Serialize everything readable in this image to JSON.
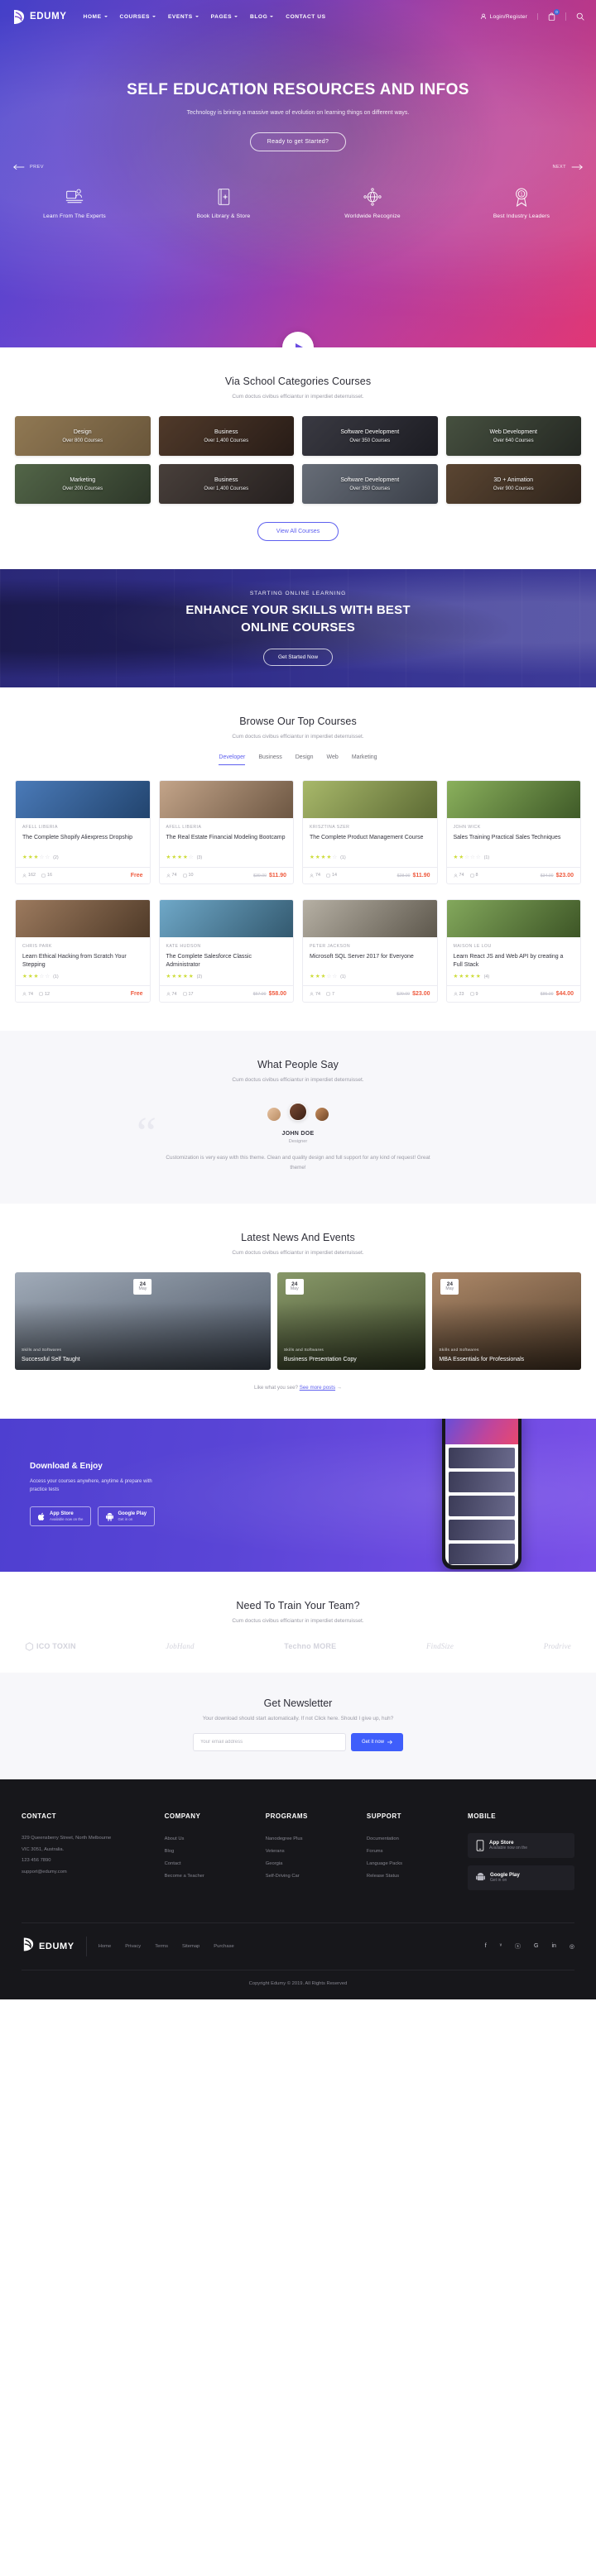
{
  "header": {
    "brand": "EDUMY",
    "nav": [
      {
        "label": "HOME",
        "has_caret": true
      },
      {
        "label": "COURSES",
        "has_caret": true
      },
      {
        "label": "EVENTS",
        "has_caret": true
      },
      {
        "label": "PAGES",
        "has_caret": true
      },
      {
        "label": "BLOG",
        "has_caret": true
      },
      {
        "label": "CONTACT US",
        "has_caret": false
      }
    ],
    "login_label": "Login/Register",
    "cart_count": "0"
  },
  "hero": {
    "title": "SELF EDUCATION RESOURCES AND INFOS",
    "subtitle": "Technology is brining a massive wave of evolution on learning things on different ways.",
    "cta": "Ready to get Started?",
    "prev_label": "PREV",
    "next_label": "NEXT",
    "features": [
      {
        "label": "Learn From The Experts",
        "icon": "expert-desk-icon"
      },
      {
        "label": "Book Library & Store",
        "icon": "book-plus-icon"
      },
      {
        "label": "Worldwide Recognize",
        "icon": "globe-network-icon"
      },
      {
        "label": "Best Industry Leaders",
        "icon": "award-ribbon-icon"
      }
    ]
  },
  "categories": {
    "title": "Via School Categories Courses",
    "subtitle": "Cum doctus civibus efficiantur in imperdiet deterruisset.",
    "items": [
      {
        "name": "Design",
        "count": "Over 800 Courses",
        "c1": "#c9a66b",
        "c2": "#8f7346"
      },
      {
        "name": "Business",
        "count": "Over 1,400 Courses",
        "c1": "#6b4a2e",
        "c2": "#2e1d12"
      },
      {
        "name": "Software Development",
        "count": "Over 350 Courses",
        "c1": "#4a4a52",
        "c2": "#1d1d22"
      },
      {
        "name": "Web Development",
        "count": "Over 640 Courses",
        "c1": "#5c6b4e",
        "c2": "#2a2f23"
      },
      {
        "name": "Marketing",
        "count": "Over 200 Courses",
        "c1": "#6e8a5a",
        "c2": "#37452c"
      },
      {
        "name": "Business",
        "count": "Over 1,400 Courses",
        "c1": "#5f5247",
        "c2": "#2b231d"
      },
      {
        "name": "Software Development",
        "count": "Over 350 Courses",
        "c1": "#8c95a0",
        "c2": "#4a515a"
      },
      {
        "name": "3D + Animation",
        "count": "Over 900 Courses",
        "c1": "#7a5b3a",
        "c2": "#3a2a19"
      }
    ],
    "view_all": "View All Courses"
  },
  "enhance": {
    "kicker": "STARTING ONLINE LEARNING",
    "title_line1": "ENHANCE YOUR SKILLS WITH BEST",
    "title_line2": "ONLINE COURSES",
    "cta": "Get Started Now"
  },
  "courses": {
    "title": "Browse Our Top Courses",
    "subtitle": "Cum doctus civibus efficiantur in imperdiet deterruisset.",
    "tabs": [
      {
        "label": "Developer",
        "active": true
      },
      {
        "label": "Business",
        "active": false
      },
      {
        "label": "Design",
        "active": false
      },
      {
        "label": "Web",
        "active": false
      },
      {
        "label": "Marketing",
        "active": false
      }
    ],
    "items": [
      {
        "author": "AFELL LIBERIA",
        "title": "The Complete Shopify Aliexpress Dropship",
        "rating": 2.5,
        "reviews": "(2)",
        "students": "162",
        "lessons": "16",
        "old_price": "",
        "price": "Free",
        "free": true,
        "c1": "#4a7ab8",
        "c2": "#22446e"
      },
      {
        "author": "AFELL LIBERIA",
        "title": "The Real Estate Financial Modeling Bootcamp",
        "rating": 4.0,
        "reviews": "(3)",
        "students": "74",
        "lessons": "10",
        "old_price": "$39.00",
        "price": "$11.90",
        "free": false,
        "c1": "#c3a489",
        "c2": "#6d5743"
      },
      {
        "author": "KRISZTINA SZER",
        "title": "The Complete Product Management Course",
        "rating": 4.0,
        "reviews": "(1)",
        "students": "74",
        "lessons": "14",
        "old_price": "$28.00",
        "price": "$11.90",
        "free": false,
        "c1": "#a8b86a",
        "c2": "#5c6a34"
      },
      {
        "author": "JOHN WICK",
        "title": "Sales Training Practical Sales Techniques",
        "rating": 2.0,
        "reviews": "(1)",
        "students": "74",
        "lessons": "8",
        "old_price": "$34.00",
        "price": "$23.00",
        "free": false,
        "c1": "#8ab05c",
        "c2": "#3f5a28"
      },
      {
        "author": "CHRIS PARK",
        "title": "Learn Ethical Hacking from Scratch Your Stepping",
        "rating": 3.0,
        "reviews": "(1)",
        "students": "74",
        "lessons": "12",
        "old_price": "",
        "price": "Free",
        "free": true,
        "c1": "#9c7a5e",
        "c2": "#4f3a28"
      },
      {
        "author": "KATE HUDSON",
        "title": "The Complete Salesforce Classic Administrator",
        "rating": 4.5,
        "reviews": "(2)",
        "students": "74",
        "lessons": "17",
        "old_price": "$67.00",
        "price": "$58.00",
        "free": false,
        "c1": "#6fa8c8",
        "c2": "#33596f"
      },
      {
        "author": "PETER JACKSON",
        "title": "Microsoft SQL Server 2017 for Everyone",
        "rating": 3.0,
        "reviews": "(1)",
        "students": "74",
        "lessons": "7",
        "old_price": "$29.00",
        "price": "$23.00",
        "free": false,
        "c1": "#b6b0a4",
        "c2": "#5d574c"
      },
      {
        "author": "MAISON LE LOU",
        "title": "Learn React JS and Web API by creating a Full Stack",
        "rating": 5.0,
        "reviews": "(4)",
        "students": "23",
        "lessons": "9",
        "old_price": "$85.00",
        "price": "$44.00",
        "free": false,
        "c1": "#83a85c",
        "c2": "#3d5526"
      }
    ]
  },
  "testimonials": {
    "title": "What People Say",
    "subtitle": "Cum doctus civibus efficiantur in imperdiet deterruisset.",
    "name": "JOHN DOE",
    "role": "Designer",
    "quote": "Customization is very easy with this theme. Clean and quality design and full support for any kind of request! Great theme!"
  },
  "news": {
    "title": "Latest News And Events",
    "subtitle": "Cum doctus civibus efficiantur in imperdiet deterruisset.",
    "items": [
      {
        "day": "24",
        "month": "May",
        "tagline": "Skills and Softwares",
        "title": "Successful Self Taught",
        "c1": "#a9b4c2",
        "c2": "#4c5665"
      },
      {
        "day": "24",
        "month": "May",
        "tagline": "Skills and Softwares",
        "title": "Business Presentation Copy",
        "c1": "#8fa06e",
        "c2": "#3f4a2b"
      },
      {
        "day": "24",
        "month": "May",
        "tagline": "Skills and Softwares",
        "title": "MBA Essentials for Professionals",
        "c1": "#b58f6e",
        "c2": "#56402c"
      }
    ],
    "more_prefix": "Like what you see?",
    "more_link": "See more posts"
  },
  "app": {
    "title": "Download & Enjoy",
    "desc": "Access your courses anywhere, anytime & prepare with practice tests",
    "stores": [
      {
        "name": "App Store",
        "sub": "Available now on the",
        "icon": "apple-icon"
      },
      {
        "name": "Google Play",
        "sub": "Get in on",
        "icon": "android-icon"
      }
    ]
  },
  "partnersSection": {
    "title": "Need To Train Your Team?",
    "subtitle": "Cum doctus civibus efficiantur in imperdiet deterruisset.",
    "logos": [
      "ICO TOXIN",
      "JobHand",
      "Techno MORE",
      "FindSize",
      "Prodrive"
    ]
  },
  "newsletter": {
    "title": "Get Newsletter",
    "subtitle": "Your download should start automatically. If not Click here. Should I give up, huh?",
    "placeholder": "Your email address",
    "button": "Get it now"
  },
  "footer": {
    "columns": [
      {
        "head": "CONTACT",
        "lines": [
          "329 Queensberry Street, North Melbourne",
          "VIC 3051, Australia.",
          "123 456 7890",
          "support@edumy.com"
        ],
        "links": []
      },
      {
        "head": "COMPANY",
        "lines": [],
        "links": [
          "About Us",
          "Blog",
          "Contact",
          "Become a Teacher"
        ]
      },
      {
        "head": "PROGRAMS",
        "lines": [],
        "links": [
          "Nanodegree Plus",
          "Veterans",
          "Georgia",
          "Self-Driving Car"
        ]
      },
      {
        "head": "SUPPORT",
        "lines": [],
        "links": [
          "Documentation",
          "Forums",
          "Language Packs",
          "Release Status"
        ]
      }
    ],
    "mobile_head": "MOBILE",
    "brand": "EDUMY",
    "bar_links": [
      "Home",
      "Privacy",
      "Terms",
      "Sitemap",
      "Purchase"
    ],
    "social": [
      "f",
      "ᵛ",
      "ⓢ",
      "G",
      "in",
      "◎"
    ],
    "copyright": "Copyright Edumy © 2019. All Rights Reserved"
  }
}
